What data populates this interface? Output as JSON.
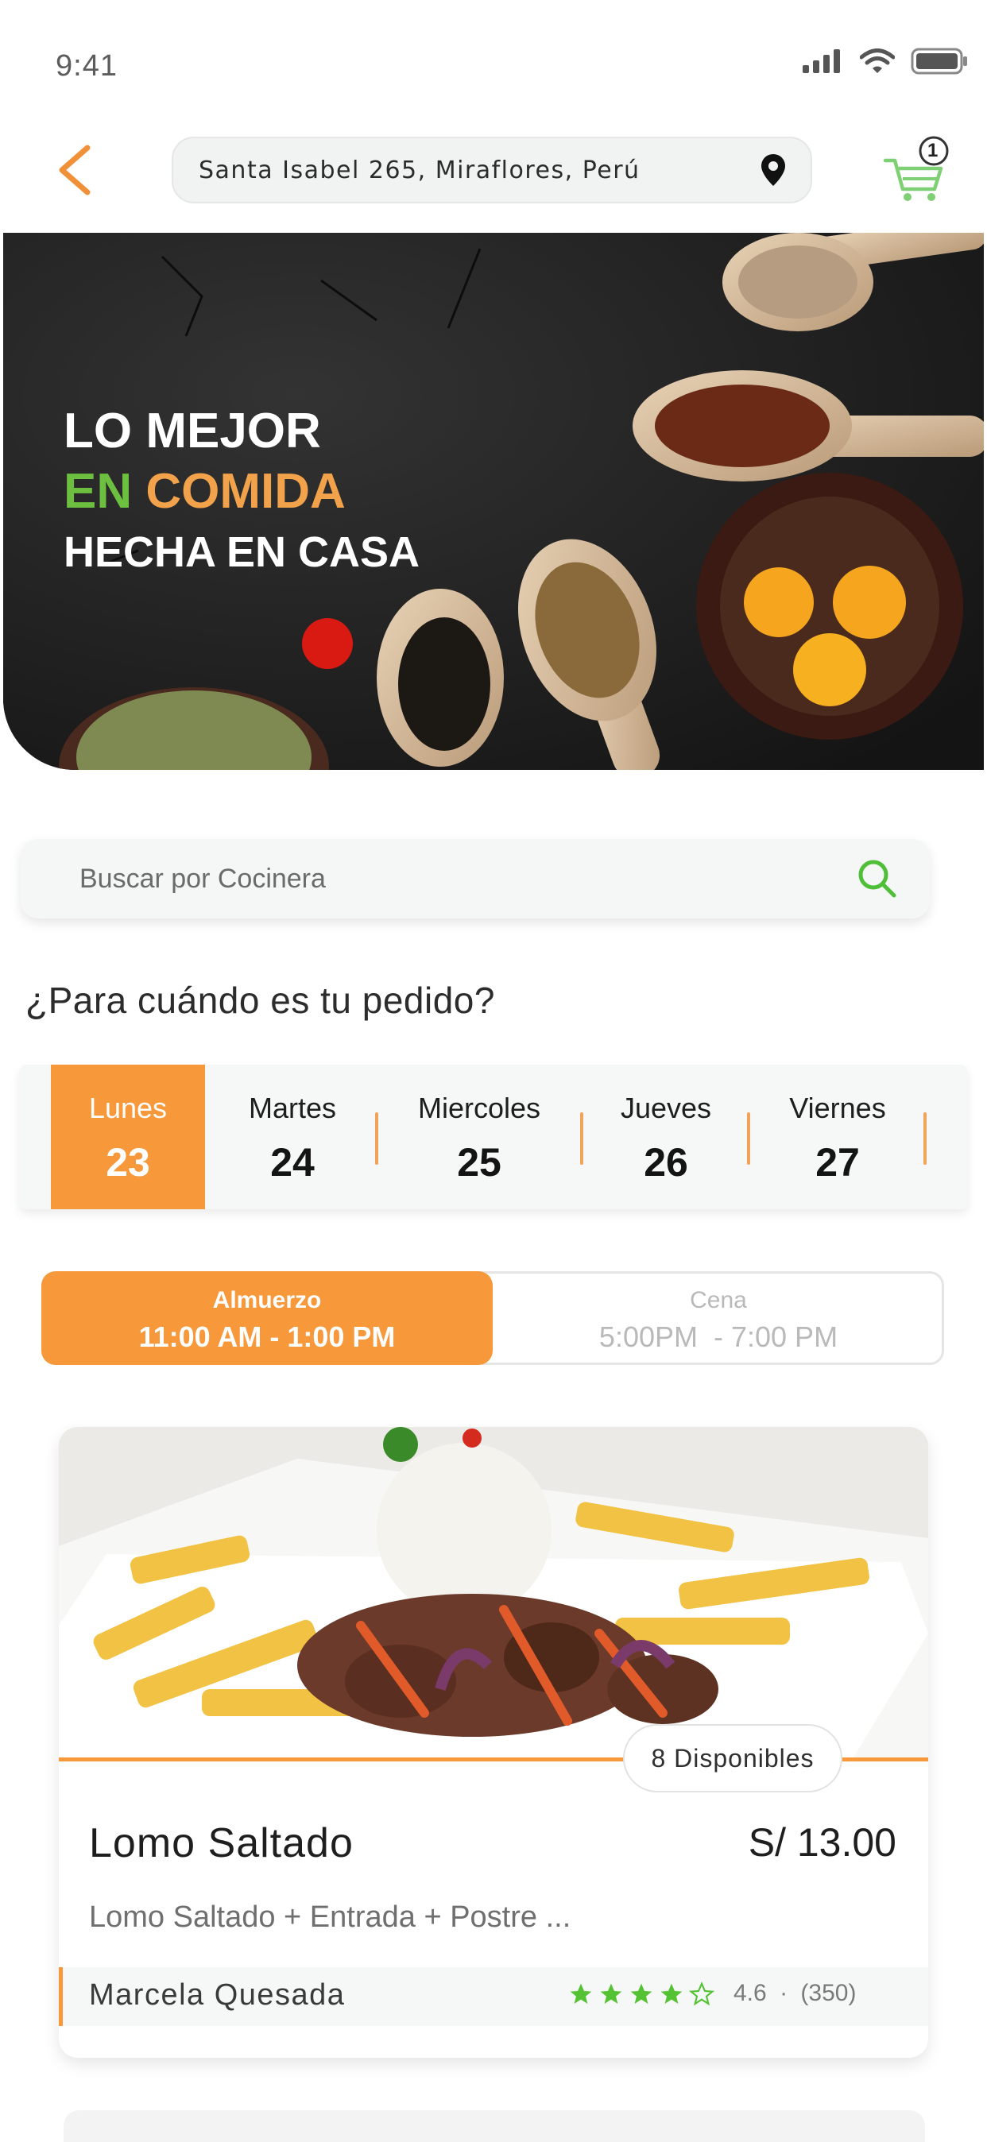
{
  "status_bar": {
    "time": "9:41"
  },
  "header": {
    "address": "Santa Isabel 265, Miraflores, Perú",
    "cart_count": "1"
  },
  "hero": {
    "line1": "LO MEJOR",
    "line2_green": "EN",
    "line2_orange": "COMIDA",
    "line3": "HECHA EN CASA"
  },
  "search": {
    "placeholder": "Buscar por Cocinera"
  },
  "question": "¿Para cuándo es tu pedido?",
  "days": [
    {
      "name": "Lunes",
      "num": "23",
      "active": true
    },
    {
      "name": "Martes",
      "num": "24"
    },
    {
      "name": "Miercoles",
      "num": "25"
    },
    {
      "name": "Jueves",
      "num": "26"
    },
    {
      "name": "Viernes",
      "num": "27"
    }
  ],
  "meals": [
    {
      "label": "Almuerzo",
      "hours": "11:00 AM - 1:00 PM",
      "active": true
    },
    {
      "label": "Cena",
      "hours": "5:00PM  - 7:00 PM"
    }
  ],
  "dish": {
    "available": "8 Disponibles",
    "name": "Lomo Saltado",
    "price": "S/ 13.00",
    "description": "Lomo Saltado + Entrada + Postre ...",
    "cook": "Marcela Quesada",
    "stars_filled": 4,
    "stars_total": 5,
    "rating": "4.6",
    "separator": "·",
    "reviews": "(350)"
  },
  "colors": {
    "accent_orange": "#f7983a",
    "accent_green": "#6cbf3f",
    "star_green": "#55c233"
  }
}
